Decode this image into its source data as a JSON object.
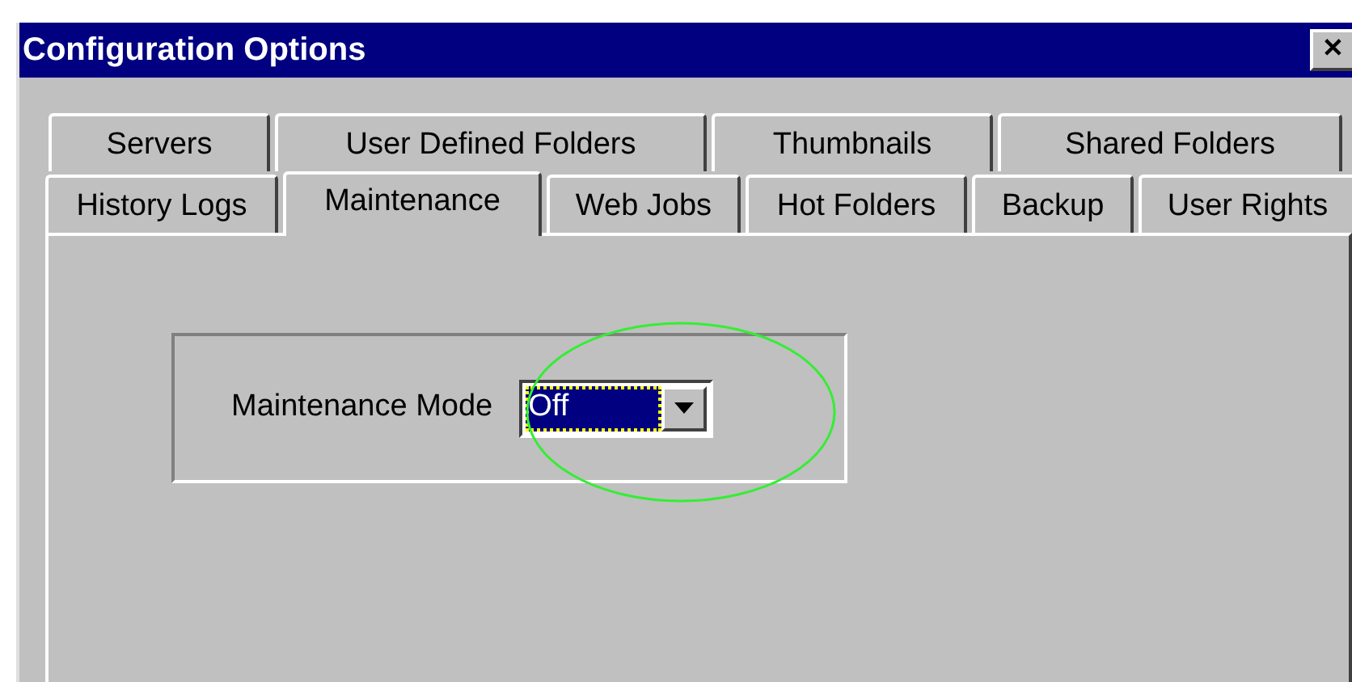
{
  "window": {
    "title": "Configuration Options",
    "close": "✕"
  },
  "tab_rows": [
    [
      {
        "label": "Servers",
        "selected": false
      },
      {
        "label": "User Defined Folders",
        "selected": false
      },
      {
        "label": "Thumbnails",
        "selected": false
      },
      {
        "label": "Shared Folders",
        "selected": false
      }
    ],
    [
      {
        "label": "History Logs",
        "selected": false
      },
      {
        "label": "Maintenance",
        "selected": true
      },
      {
        "label": "Web Jobs",
        "selected": false
      },
      {
        "label": "Hot Folders",
        "selected": false
      },
      {
        "label": "Backup",
        "selected": false
      },
      {
        "label": "User Rights",
        "selected": false
      }
    ]
  ],
  "maintenance": {
    "label": "Maintenance Mode",
    "value": "Off",
    "focused": true,
    "highlighted": true
  }
}
